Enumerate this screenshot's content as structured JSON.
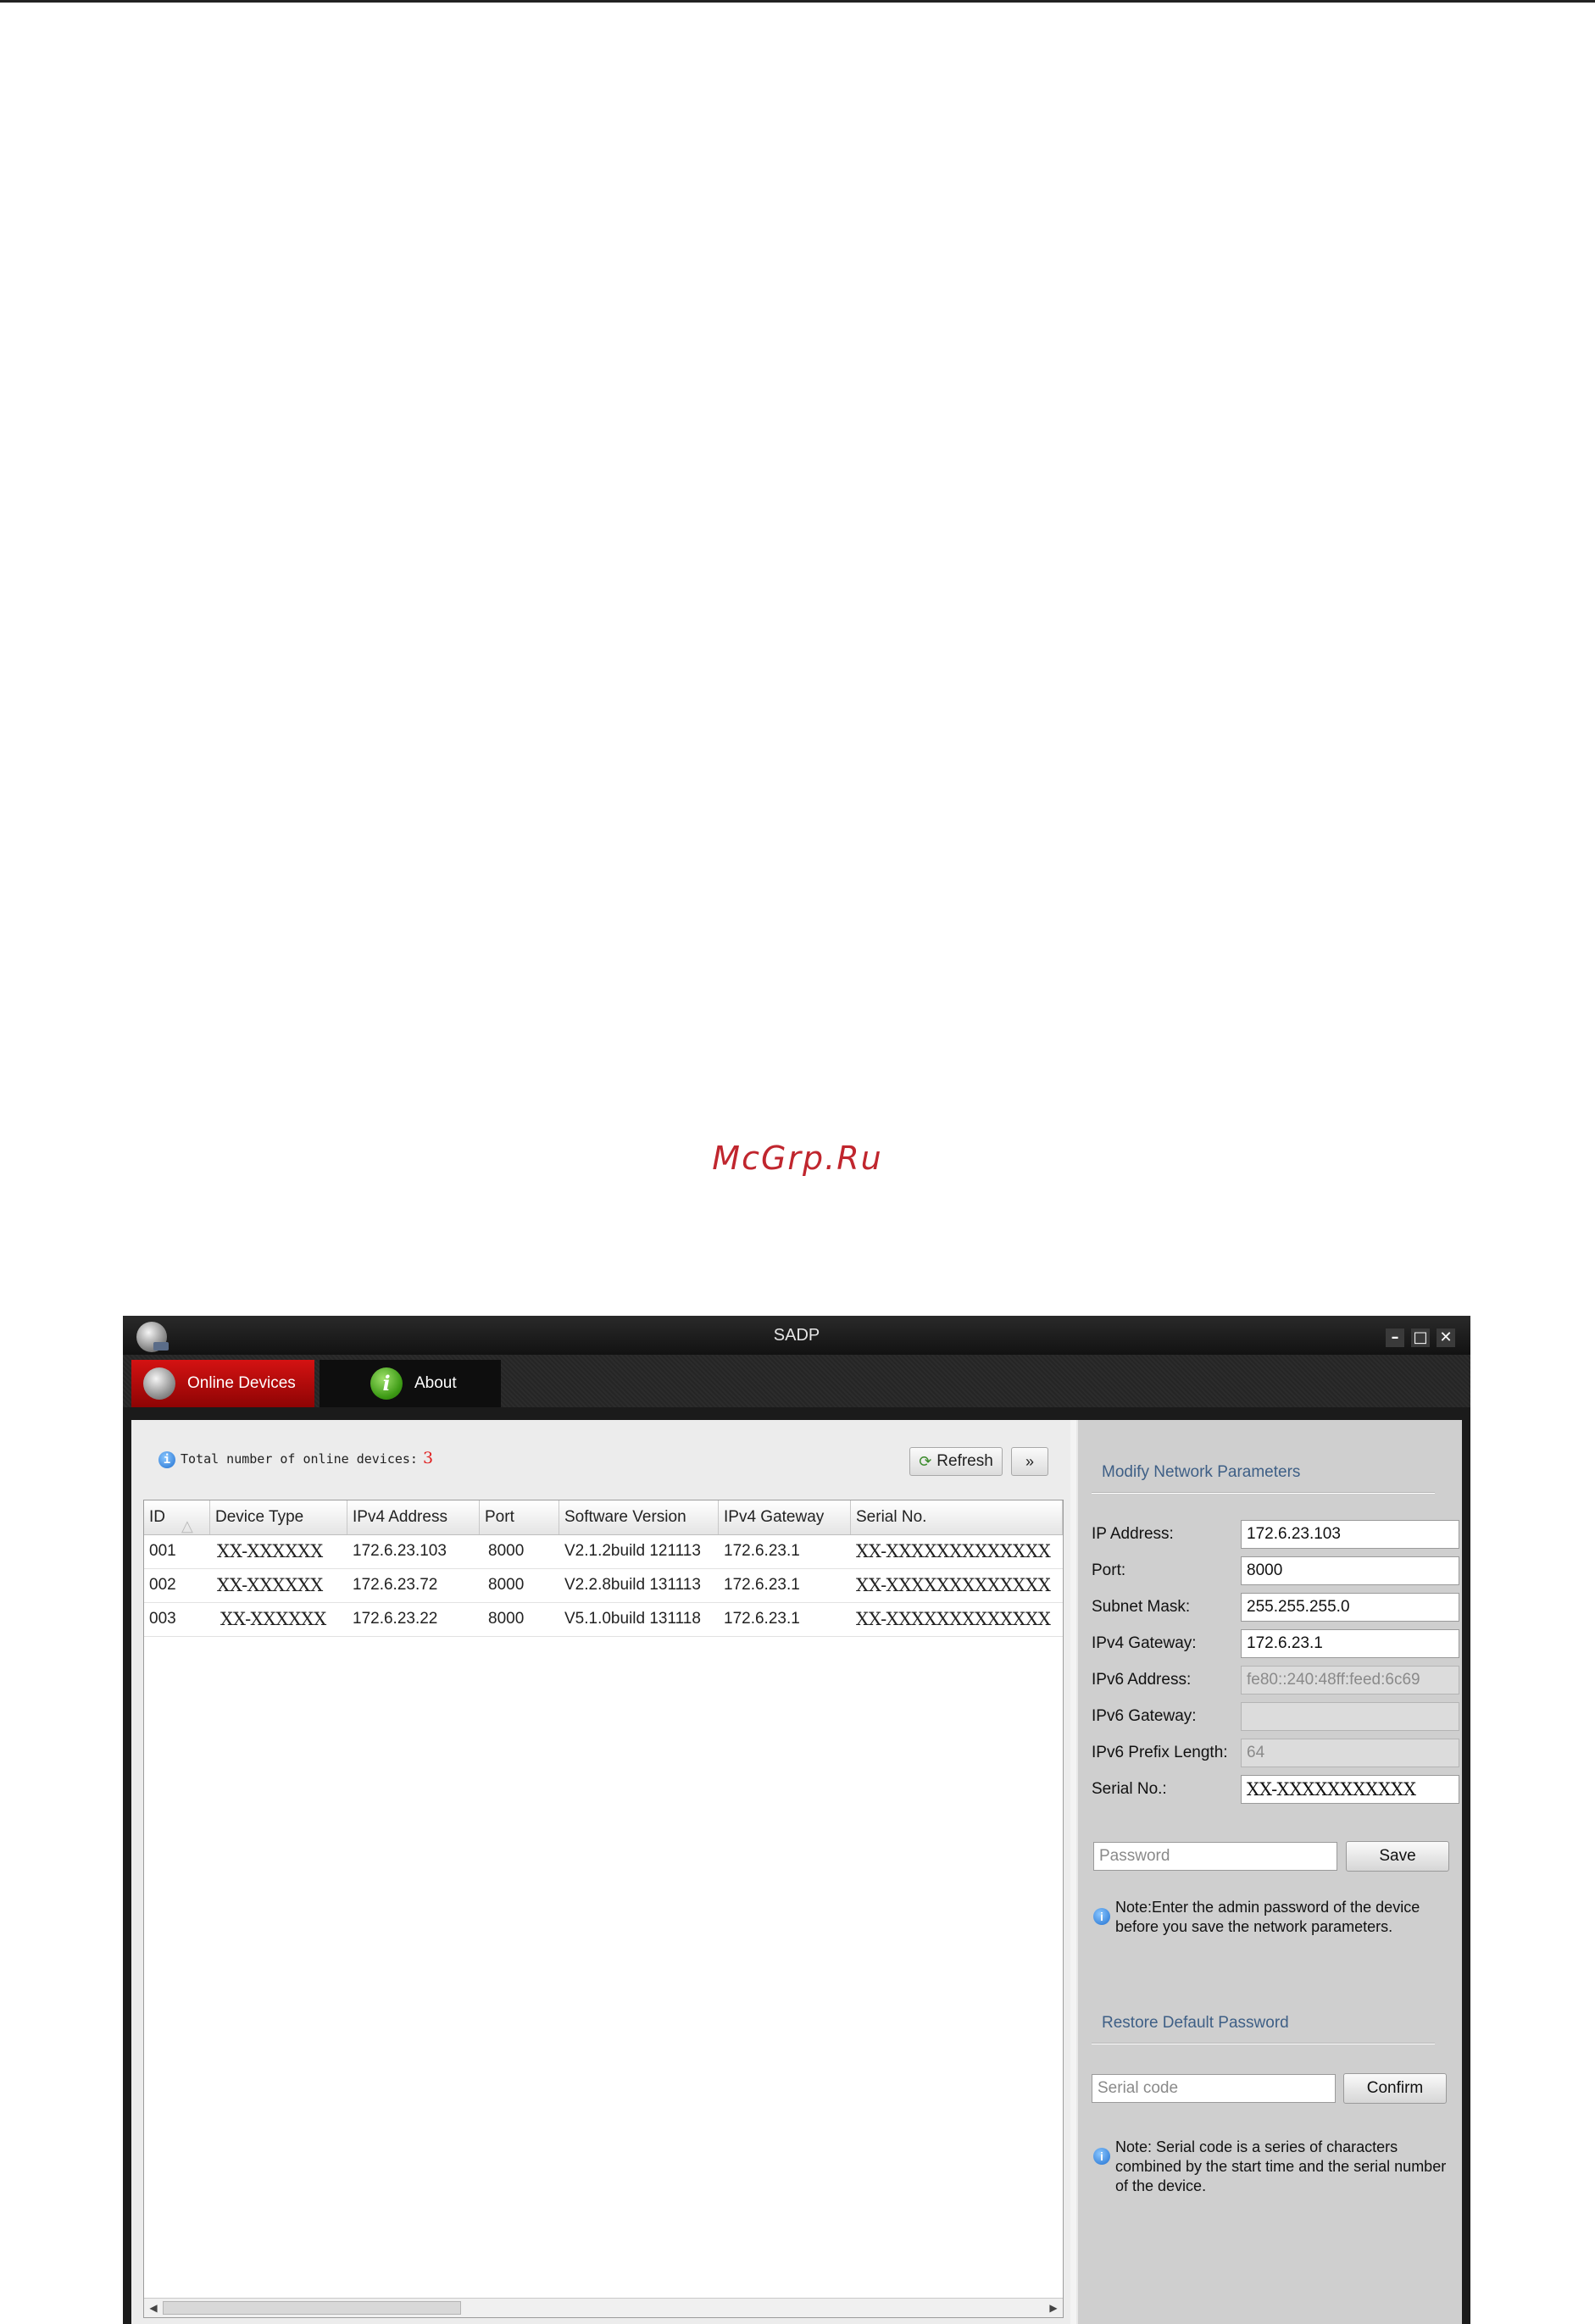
{
  "watermark": "McGrp.Ru",
  "window": {
    "title": "SADP",
    "controls": {
      "minimize": "–",
      "maximize": "□",
      "close": "✕"
    }
  },
  "tabs": {
    "online_devices": "Online Devices",
    "about": "About",
    "about_icon_glyph": "i"
  },
  "device_list": {
    "total_label": "Total number of online devices:",
    "total_count": "3",
    "refresh_label": "Refresh",
    "more_label": "»",
    "columns": [
      "ID",
      "Device Type",
      "IPv4 Address",
      "Port",
      "Software Version",
      "IPv4 Gateway",
      "Serial No."
    ],
    "rows": [
      {
        "id": "001",
        "device_type": "XX-XXXXXX",
        "ipv4": "172.6.23.103",
        "port": "8000",
        "software": "V2.1.2build 121113",
        "gateway": "172.6.23.1",
        "serial": "XX-XXXXXXXXXXXXX"
      },
      {
        "id": "002",
        "device_type": "XX-XXXXXX",
        "ipv4": "172.6.23.72",
        "port": "8000",
        "software": "V2.2.8build 131113",
        "gateway": "172.6.23.1",
        "serial": "XX-XXXXXXXXXXXXX"
      },
      {
        "id": "003",
        "device_type": "XX-XXXXXX",
        "ipv4": "172.6.23.22",
        "port": "8000",
        "software": "V5.1.0build 131118",
        "gateway": "172.6.23.1",
        "serial": "XX-XXXXXXXXXXXXX"
      }
    ]
  },
  "modify": {
    "title": "Modify Network Parameters",
    "fields": {
      "ip_address": {
        "label": "IP Address:",
        "value": "172.6.23.103"
      },
      "port": {
        "label": "Port:",
        "value": "8000"
      },
      "subnet_mask": {
        "label": "Subnet Mask:",
        "value": "255.255.255.0"
      },
      "ipv4_gateway": {
        "label": "IPv4 Gateway:",
        "value": "172.6.23.1"
      },
      "ipv6_address": {
        "label": "IPv6 Address:",
        "value": "fe80::240:48ff:feed:6c69"
      },
      "ipv6_gateway": {
        "label": "IPv6 Gateway:",
        "value": ""
      },
      "ipv6_prefix": {
        "label": "IPv6 Prefix Length:",
        "value": "64"
      },
      "serial_no": {
        "label": "Serial No.:",
        "value": "XX-XXXXXXXXXXX"
      }
    },
    "password_placeholder": "Password",
    "save_label": "Save",
    "note": "Note:Enter the admin password of the device before you save the network parameters."
  },
  "restore": {
    "title": "Restore Default Password",
    "serial_placeholder": "Serial code",
    "confirm_label": "Confirm",
    "note": "Note: Serial code is a series of characters combined by the start time and the serial number of the device."
  },
  "colors": {
    "active_tab": "#c80c0c",
    "section_title": "#3e5f86",
    "count": "#e02020",
    "watermark": "#c0262e"
  },
  "icons": [
    "sadp-app-icon",
    "online-devices-icon",
    "about-info-icon",
    "info-icon",
    "refresh-icon"
  ]
}
